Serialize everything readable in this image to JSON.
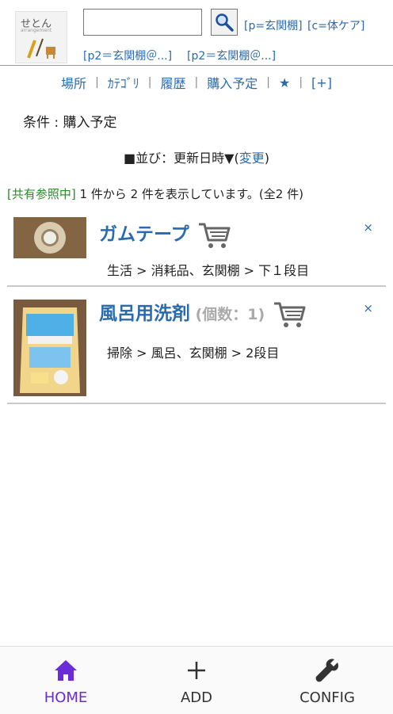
{
  "header": {
    "logo_text": "せとん",
    "logo_sub": "arrangement",
    "search_placeholder": "",
    "quick_links": [
      "[p=玄関棚]",
      "[c=体ケア]",
      "[p2＝玄関棚＠...]",
      "[p2＝玄関棚＠...]"
    ]
  },
  "nav": {
    "items": [
      "場所",
      "ｶﾃｺﾞﾘ",
      "履歴",
      "購入予定",
      "★",
      "[+]"
    ],
    "separator": "|"
  },
  "condition": "条件 : 購入予定",
  "sort": {
    "prefix": "■並び：更新日時▼(",
    "link": "変更",
    "suffix": ")"
  },
  "count": {
    "shared": "[共有参照中]",
    "text": " 1 件から 2 件を表示しています。(全2 件)"
  },
  "items": [
    {
      "title": "ガムテープ",
      "qty": "",
      "path": "生活 > 消耗品、玄関棚 > 下１段目",
      "delete": "×"
    },
    {
      "title": "風呂用洗剤",
      "qty": " (個数：1)",
      "path": "掃除 > 風呂、玄関棚 > 2段目",
      "delete": "×"
    }
  ],
  "tabs": [
    {
      "label": "HOME",
      "icon": "home-icon",
      "active": true
    },
    {
      "label": "ADD",
      "icon": "plus-icon",
      "active": false
    },
    {
      "label": "CONFIG",
      "icon": "wrench-icon",
      "active": false
    }
  ],
  "colors": {
    "link": "#2a6bb0",
    "shared": "#2a8a2a",
    "active_tab": "#6a2bd9"
  }
}
